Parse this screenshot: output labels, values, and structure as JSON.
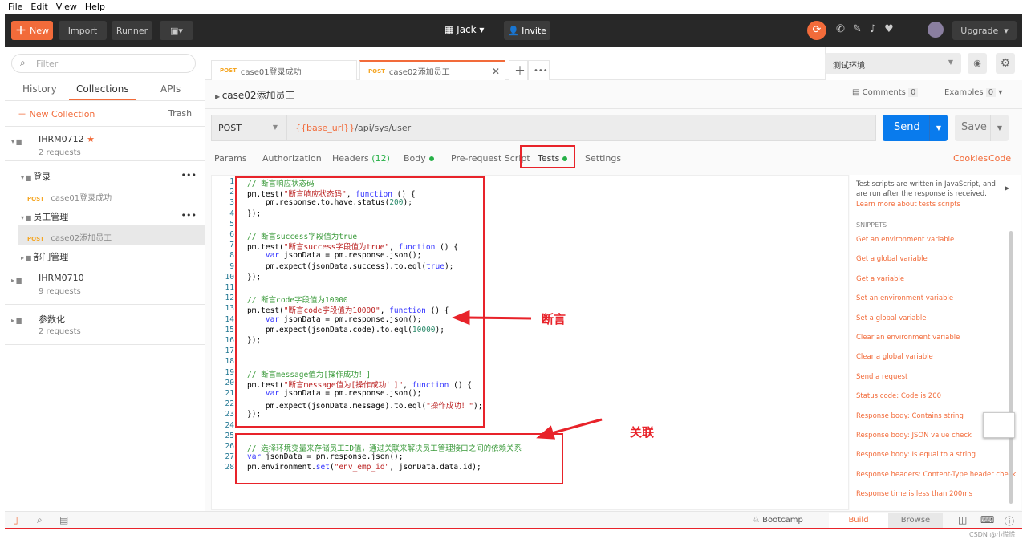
{
  "menu": [
    "File",
    "Edit",
    "View",
    "Help"
  ],
  "topbar": {
    "new": "New",
    "import": "Import",
    "runner": "Runner",
    "workspace": "Jack",
    "invite": "Invite",
    "upgrade": "Upgrade",
    "accent": "#f26b3a"
  },
  "sidebar": {
    "filter_placeholder": "Filter",
    "tabs": [
      "History",
      "Collections",
      "APIs"
    ],
    "new_collection": "New Collection",
    "trash": "Trash",
    "collections": [
      {
        "name": "IHRM0712",
        "count": "2 requests"
      },
      {
        "name": "IHRM0710",
        "count": "9 requests"
      },
      {
        "name": "参数化",
        "count": "2 requests"
      }
    ],
    "folders": [
      "登录",
      "员工管理",
      "部门管理"
    ],
    "requests": [
      {
        "method": "POST",
        "name": "case01登录成功"
      },
      {
        "method": "POST",
        "name": "case02添加员工"
      }
    ]
  },
  "tabs": [
    {
      "method": "POST",
      "name": "case01登录成功"
    },
    {
      "method": "POST",
      "name": "case02添加员工"
    }
  ],
  "env": {
    "selected": "测试环境"
  },
  "request": {
    "title": "case02添加员工",
    "comments": "Comments",
    "comments_count": "0",
    "examples": "Examples",
    "examples_count": "0",
    "method": "POST",
    "url_var": "{{base_url}}",
    "url_path": "/api/sys/user",
    "send": "Send",
    "save": "Save"
  },
  "subtabs": {
    "params": "Params",
    "auth": "Authorization",
    "headers": "Headers",
    "headers_count": "(12)",
    "body": "Body",
    "prereq": "Pre-request Script",
    "tests": "Tests",
    "settings": "Settings",
    "cookies": "Cookies",
    "code": "Code"
  },
  "code": [
    [
      [
        "c",
        "// 断言响应状态码"
      ]
    ],
    [
      [
        "t",
        "pm.test("
      ],
      [
        "s",
        "\"断言响应状态码\""
      ],
      [
        "t",
        ", "
      ],
      [
        "k",
        "function"
      ],
      [
        "t",
        " () {"
      ]
    ],
    [
      [
        "t",
        "    pm.response.to.have.status("
      ],
      [
        "n",
        "200"
      ],
      [
        "t",
        ");"
      ]
    ],
    [
      [
        "t",
        "});"
      ]
    ],
    [],
    [
      [
        "c",
        "// 断言success字段值为true"
      ]
    ],
    [
      [
        "t",
        "pm.test("
      ],
      [
        "s",
        "\"断言success字段值为true\""
      ],
      [
        "t",
        ", "
      ],
      [
        "k",
        "function"
      ],
      [
        "t",
        " () {"
      ]
    ],
    [
      [
        "t",
        "    "
      ],
      [
        "k",
        "var"
      ],
      [
        "t",
        " jsonData = pm.response.json();"
      ]
    ],
    [
      [
        "t",
        "    pm.expect(jsonData.success).to.eql("
      ],
      [
        "k",
        "true"
      ],
      [
        "t",
        ");"
      ]
    ],
    [
      [
        "t",
        "});"
      ]
    ],
    [],
    [
      [
        "c",
        "// 断言code字段值为10000"
      ]
    ],
    [
      [
        "t",
        "pm.test("
      ],
      [
        "s",
        "\"断言code字段值为10000\""
      ],
      [
        "t",
        ", "
      ],
      [
        "k",
        "function"
      ],
      [
        "t",
        " () {"
      ]
    ],
    [
      [
        "t",
        "    "
      ],
      [
        "k",
        "var"
      ],
      [
        "t",
        " jsonData = pm.response.json();"
      ]
    ],
    [
      [
        "t",
        "    pm.expect(jsonData.code).to.eql("
      ],
      [
        "n",
        "10000"
      ],
      [
        "t",
        ");"
      ]
    ],
    [
      [
        "t",
        "});"
      ]
    ],
    [],
    [],
    [
      [
        "c",
        "// 断言message值为[操作成功！]"
      ]
    ],
    [
      [
        "t",
        "pm.test("
      ],
      [
        "s",
        "\"断言message值为[操作成功！]\""
      ],
      [
        "t",
        ", "
      ],
      [
        "k",
        "function"
      ],
      [
        "t",
        " () {"
      ]
    ],
    [
      [
        "t",
        "    "
      ],
      [
        "k",
        "var"
      ],
      [
        "t",
        " jsonData = pm.response.json();"
      ]
    ],
    [
      [
        "t",
        "    pm.expect(jsonData.message).to.eql("
      ],
      [
        "s",
        "\"操作成功！\""
      ],
      [
        "t",
        ");"
      ]
    ],
    [
      [
        "t",
        "});"
      ]
    ],
    [],
    [],
    [
      [
        "c",
        "// 选择环境变量来存储员工ID值，通过关联来解决员工管理接口之间的依赖关系"
      ]
    ],
    [
      [
        "k",
        "var"
      ],
      [
        "t",
        " jsonData = pm.response.json();"
      ]
    ],
    [
      [
        "t",
        "pm.environment."
      ],
      [
        "k",
        "set"
      ],
      [
        "t",
        "("
      ],
      [
        "s",
        "\"env_emp_id\""
      ],
      [
        "t",
        ", jsonData.data.id);"
      ]
    ]
  ],
  "snippets": {
    "intro": "Test scripts are written in JavaScript, and are run after the response is received.",
    "learn": "Learn more about tests scripts",
    "heading": "SNIPPETS",
    "items": [
      "Get an environment variable",
      "Get a global variable",
      "Get a variable",
      "Set an environment variable",
      "Set a global variable",
      "Clear an environment variable",
      "Clear a global variable",
      "Send a request",
      "Status code: Code is 200",
      "Response body: Contains string",
      "Response body: JSON value check",
      "Response body: Is equal to a string",
      "Response headers: Content-Type header check",
      "Response time is less than 200ms"
    ]
  },
  "annotations": {
    "assert": "断言",
    "relate": "关联"
  },
  "bottom": {
    "bootcamp": "Bootcamp",
    "build": "Build",
    "browse": "Browse"
  },
  "watermark": "CSDN @小慌慌"
}
